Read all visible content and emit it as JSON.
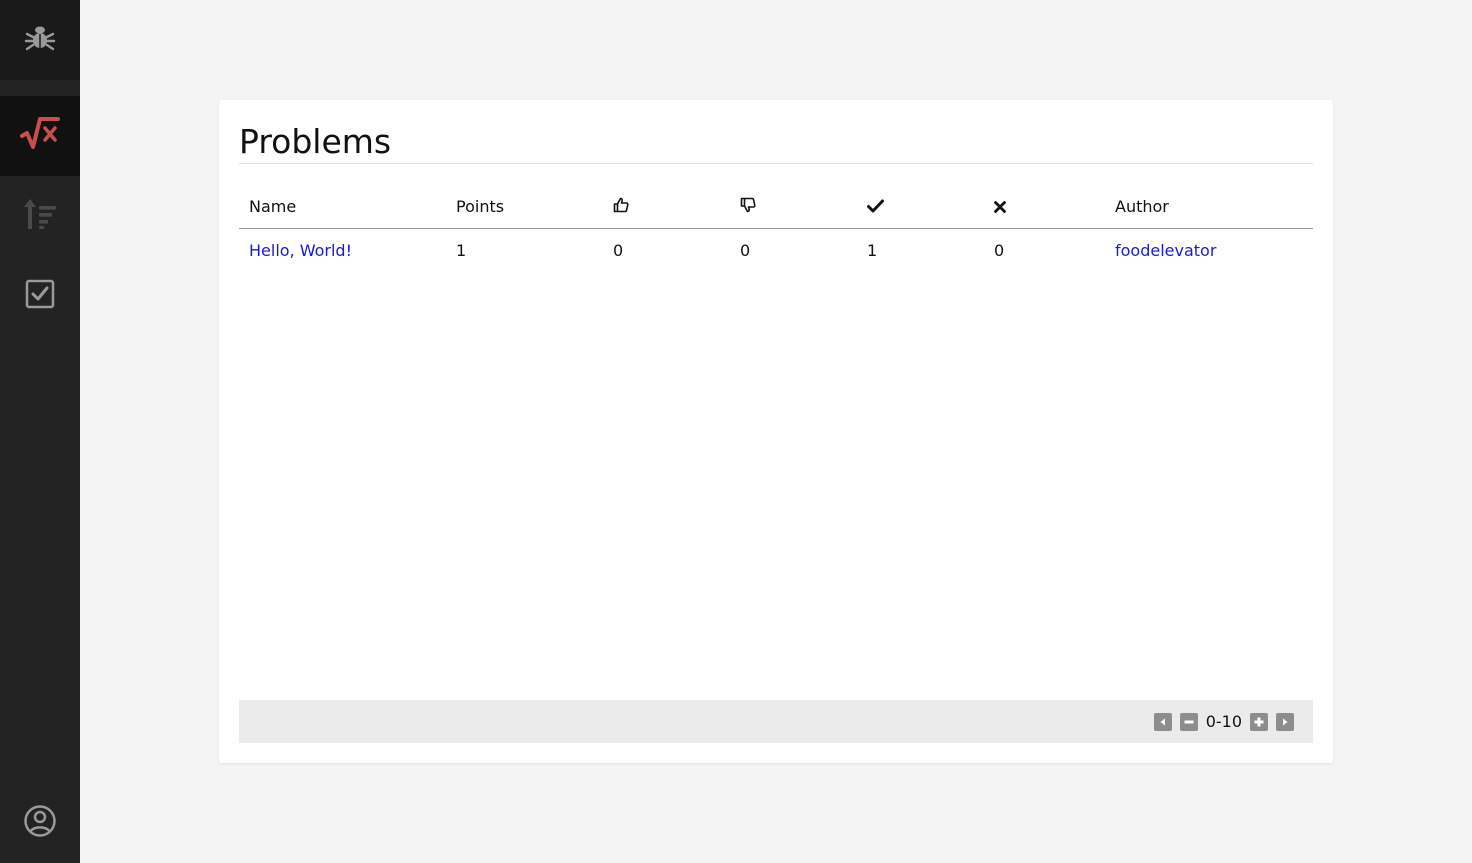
{
  "sidebar": {
    "logo_icon": "bug-icon",
    "items": [
      {
        "name": "problems",
        "icon": "square-root-icon",
        "active": true
      },
      {
        "name": "rankings",
        "icon": "sort-amount-icon",
        "active": false
      },
      {
        "name": "submissions",
        "icon": "checkbox-icon",
        "active": false
      }
    ],
    "account_icon": "user-circle-icon"
  },
  "page": {
    "title": "Problems"
  },
  "table": {
    "headers": {
      "name": "Name",
      "points": "Points",
      "likes_icon": "thumbs-up-icon",
      "dislikes_icon": "thumbs-down-icon",
      "solved_icon": "check-icon",
      "failed_icon": "x-icon",
      "author": "Author"
    },
    "rows": [
      {
        "name": "Hello, World!",
        "points": "1",
        "likes": "0",
        "dislikes": "0",
        "solved": "1",
        "failed": "0",
        "author": "foodelevator"
      }
    ]
  },
  "pagination": {
    "range": "0-10"
  },
  "colors": {
    "sidebar_bg": "#232323",
    "active_bg": "#111111",
    "accent": "#c94f4f",
    "link": "#1a1adb",
    "pager_bg": "#ebebeb"
  }
}
